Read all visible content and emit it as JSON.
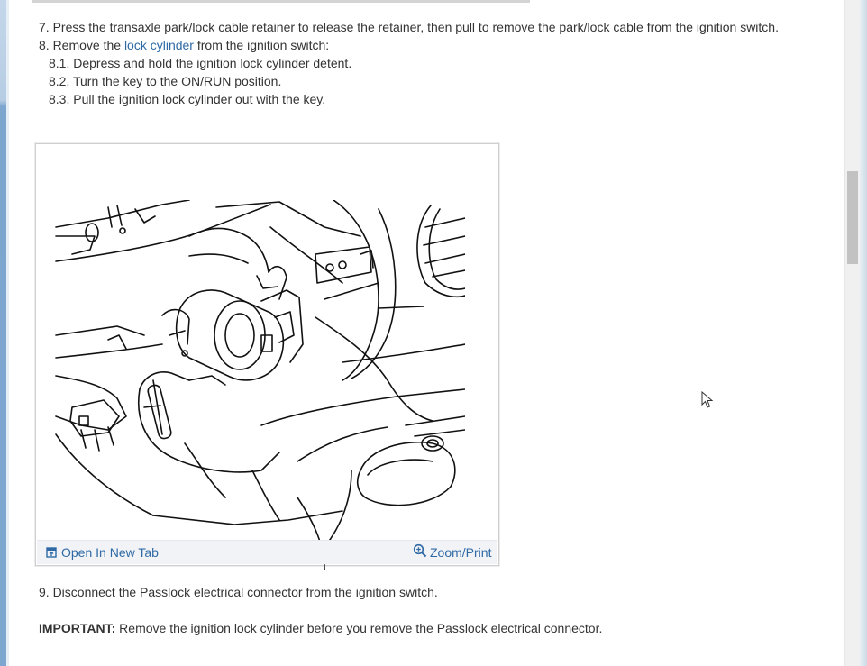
{
  "steps": {
    "step7": "7. Press the transaxle park/lock cable retainer to release the retainer, then pull to remove the park/lock cable from the ignition switch.",
    "step8_prefix": "8. Remove the ",
    "step8_link": "lock cylinder",
    "step8_suffix": " from the ignition switch:",
    "step8_1": "8.1. Depress and hold the ignition lock cylinder detent.",
    "step8_2": "8.2. Turn the key to the ON/RUN position.",
    "step8_3": "8.3. Pull the ignition lock cylinder out with the key.",
    "step9": "9. Disconnect the Passlock electrical connector from the ignition switch.",
    "important_label": "IMPORTANT:",
    "important_text": " Remove the ignition lock cylinder before you remove the Passlock electrical connector."
  },
  "figure": {
    "open_new_tab": "Open In New Tab",
    "zoom_print": "Zoom/Print"
  },
  "icons": {
    "open_tab": "open-new-tab-icon",
    "zoom": "magnifier-zoom-icon",
    "cursor": "mouse-pointer-icon"
  }
}
